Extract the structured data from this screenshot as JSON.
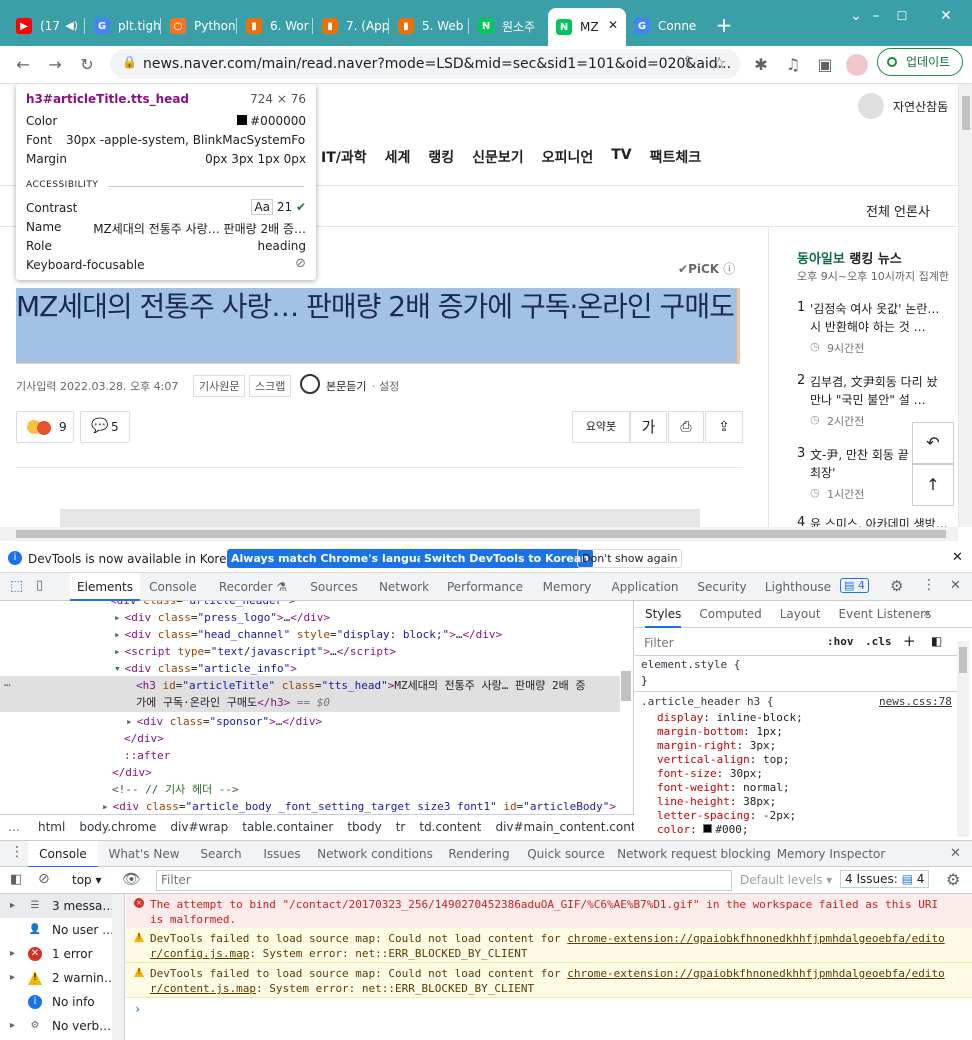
{
  "tabs": [
    {
      "label": "(17",
      "icon": "youtube-icon",
      "color": "#ff0000"
    },
    {
      "label": "plt.tigh",
      "icon": "google-icon",
      "color": "#4285f4"
    },
    {
      "label": "Python",
      "icon": "jupyter-icon",
      "color": "#f37626"
    },
    {
      "label": "6. Wor",
      "icon": "book-icon",
      "color": "#e8710a"
    },
    {
      "label": "7. (App",
      "icon": "book-icon",
      "color": "#e8710a"
    },
    {
      "label": "5. Web",
      "icon": "book-icon",
      "color": "#e8710a"
    },
    {
      "label": "원소주",
      "icon": "naver-icon",
      "color": "#03c75a"
    },
    {
      "label": "MZ",
      "icon": "naver-icon",
      "color": "#03c75a"
    },
    {
      "label": "Conne",
      "icon": "google-icon",
      "color": "#4285f4"
    }
  ],
  "browser": {
    "url": "news.naver.com/main/read.naver?mode=LSD&mid=sec&sid1=101&oid=020&aid...",
    "update_label": "업데이트"
  },
  "page": {
    "user_label": "자연산참돔",
    "nav": [
      "IT/과학",
      "세계",
      "랭킹",
      "신문보기",
      "오피니언",
      "TV",
      "팩트체크"
    ],
    "all_press": "전체 언론사",
    "pick": "PiCK",
    "title": "MZ세대의 전통주 사랑… 판매량 2배 증가에 구독·온라인 구매도",
    "date": "기사입력 2022.03.28. 오후 4:07",
    "btn_original": "기사원문",
    "btn_scrap": "스크랩",
    "listen": "본문듣기",
    "listen_setting": "설정",
    "reaction_count": "9",
    "comment_count": "5",
    "summary_btn": "요약봇",
    "font_btn": "가",
    "ranking": {
      "press": "동아일보",
      "title": "랭킹 뉴스",
      "subtitle": "오후 9시~오후 10시까지 집계한",
      "items": [
        {
          "num": "1",
          "text1": "'김정숙 여사 옷값' 논란…",
          "text2": "시 반환해야 하는 것 …",
          "time": "9시간전"
        },
        {
          "num": "2",
          "text1": "김부겸, 文尹회동 다리 놨",
          "text2": "만나 \"국민 불안\" 설 …",
          "time": "2시간전"
        },
        {
          "num": "3",
          "text1": "文-尹, 만찬 회동 끝",
          "text2": "최장'",
          "time": "1시간전"
        },
        {
          "num": "4",
          "text1": "윤 스미스, 아카데미 생방…",
          "text2": "",
          "time": ""
        }
      ]
    }
  },
  "inspect_tooltip": {
    "selector": "h3#articleTitle.tts_head",
    "size": "724 × 76",
    "color_label": "Color",
    "color_val": "#000000",
    "font_label": "Font",
    "font_val": "30px -apple-system, BlinkMacSystemFon…",
    "margin_label": "Margin",
    "margin_val": "0px 3px 1px 0px",
    "a11y_label": "ACCESSIBILITY",
    "contrast_label": "Contrast",
    "contrast_aa": "Aa",
    "contrast_val": "21",
    "name_label": "Name",
    "name_val": "MZ세대의 전통주 사랑… 판매량 2배 증…",
    "role_label": "Role",
    "role_val": "heading",
    "kbd_label": "Keyboard-focusable"
  },
  "infobar": {
    "text": "DevTools is now available in Korean!",
    "btn1": "Always match Chrome's language",
    "btn2": "Switch DevTools to Korean",
    "btn3": "Don't show again"
  },
  "devtools_tabs": [
    "Elements",
    "Console",
    "Recorder",
    "Sources",
    "Network",
    "Performance",
    "Memory",
    "Application",
    "Security",
    "Lighthouse"
  ],
  "issues_badge": "4",
  "elements": {
    "lines": [
      {
        "indent": 110,
        "html": "<span class='tag'>&lt;div</span> <span class='attr'>class</span>=<span class='val'>\"article_header\"</span><span class='tag'>&gt;</span>"
      },
      {
        "indent": 124,
        "html": "<span class='tag'>&lt;div</span> <span class='attr'>class</span>=<span class='val'>\"press_logo\"</span><span class='tag'>&gt;</span>…<span class='tag'>&lt;/div&gt;</span>"
      },
      {
        "indent": 124,
        "html": "<span class='tag'>&lt;div</span> <span class='attr'>class</span>=<span class='val'>\"head_channel\"</span> <span class='attr'>style</span>=<span class='val'>\"display: block;\"</span><span class='tag'>&gt;</span>…<span class='tag'>&lt;/div&gt;</span>"
      },
      {
        "indent": 124,
        "html": "<span class='tag'>&lt;script</span> <span class='attr'>type</span>=<span class='val'>\"text/javascript\"</span><span class='tag'>&gt;</span>…<span class='tag'>&lt;/script&gt;</span>"
      },
      {
        "indent": 124,
        "html": "<span class='tag'>&lt;div</span> <span class='attr'>class</span>=<span class='val'>\"article_info\"</span><span class='tag'>&gt;</span>"
      }
    ],
    "selected_line1": "<span class='tag'>&lt;h3</span> <span class='attr'>id</span>=<span class='val'>\"articleTitle\"</span> <span class='attr'>class</span>=<span class='val'>\"tts_head\"</span><span class='tag'>&gt;</span>MZ세대의 전통주 사랑… 판매량 2배 증",
    "selected_line2": "가에 구독·온라인 구매도<span class='tag'>&lt;/h3&gt;</span> == $0",
    "after_lines": [
      {
        "indent": 136,
        "html": "<span class='tag'>&lt;div</span> <span class='attr'>class</span>=<span class='val'>\"sponsor\"</span><span class='tag'>&gt;</span>…<span class='tag'>&lt;/div&gt;</span>"
      },
      {
        "indent": 124,
        "html": "<span class='tag'>&lt;/div&gt;</span>"
      },
      {
        "indent": 124,
        "html": "<span class='tag'>::after</span>"
      },
      {
        "indent": 112,
        "html": "<span class='tag'>&lt;/div&gt;</span>"
      },
      {
        "indent": 112,
        "html": "<span class='cm'>&lt;!-- // 기사 헤더 --&gt;</span>"
      },
      {
        "indent": 112,
        "html": "<span class='tag'>&lt;div</span> <span class='attr'>class</span>=<span class='val'>\"article_body _font_setting_target size3 font1\"</span> <span class='attr'>id</span>=<span class='val'>\"articleBody\"</span><span class='tag'>&gt;</span>"
      }
    ],
    "breadcrumbs": [
      "html",
      "body.chrome",
      "div#wrap",
      "table.container",
      "tbody",
      "tr",
      "td.content",
      "div#main_content.content",
      "c"
    ]
  },
  "styles": {
    "tabs": [
      "Styles",
      "Computed",
      "Layout",
      "Event Listeners"
    ],
    "filter_placeholder": "Filter",
    "hov": ":hov",
    "cls": ".cls",
    "element_style": "element.style {",
    "rule_selector": ".article_header h3 {",
    "rule_source": "news.css:78",
    "props": [
      {
        "name": "display",
        "val": "inline-block;"
      },
      {
        "name": "margin-bottom",
        "val": "1px;"
      },
      {
        "name": "margin-right",
        "val": "3px;"
      },
      {
        "name": "vertical-align",
        "val": "top;"
      },
      {
        "name": "font-size",
        "val": "30px;"
      },
      {
        "name": "font-weight",
        "val": "normal;"
      },
      {
        "name": "line-height",
        "val": "38px;"
      },
      {
        "name": "letter-spacing",
        "val": "-2px;"
      },
      {
        "name": "color",
        "val": "#000;"
      }
    ]
  },
  "drawer_tabs": [
    "Console",
    "What's New",
    "Search",
    "Issues",
    "Network conditions",
    "Rendering",
    "Quick source",
    "Network request blocking",
    "Memory Inspector"
  ],
  "console": {
    "context": "top",
    "filter_placeholder": "Filter",
    "levels": "Default levels",
    "issues": "4 Issues:",
    "issues_count": "4",
    "sidebar": [
      {
        "label": "3 messa…",
        "icon": "list-icon"
      },
      {
        "label": "No user …",
        "icon": "user-icon"
      },
      {
        "label": "1 error",
        "icon": "error-icon"
      },
      {
        "label": "2 warnin…",
        "icon": "warning-icon"
      },
      {
        "label": "No info",
        "icon": "info-icon"
      },
      {
        "label": "No verb…",
        "icon": "gear-icon"
      }
    ],
    "messages": [
      {
        "type": "error",
        "text1": "The attempt to bind \"/contact/20170323_256/1490270452386aduOA_GIF/%C6%AE%B7%D1.gif\" in the workspace failed as this URI",
        "text2": "is malformed."
      },
      {
        "type": "warning",
        "text1": "DevTools failed to load source map: Could not load content for ",
        "link1": "chrome-extension://gpaiobkfhnonedkhhfjpmhdalgeoebfa/edito",
        "link2": "r/config.js.map",
        "text2": ": System error: net::ERR_BLOCKED_BY_CLIENT"
      },
      {
        "type": "warning",
        "text1": "DevTools failed to load source map: Could not load content for ",
        "link1": "chrome-extension://gpaiobkfhnonedkhhfjpmhdalgeoebfa/edito",
        "link2": "r/content.js.map",
        "text2": ": System error: net::ERR_BLOCKED_BY_CLIENT"
      }
    ]
  }
}
